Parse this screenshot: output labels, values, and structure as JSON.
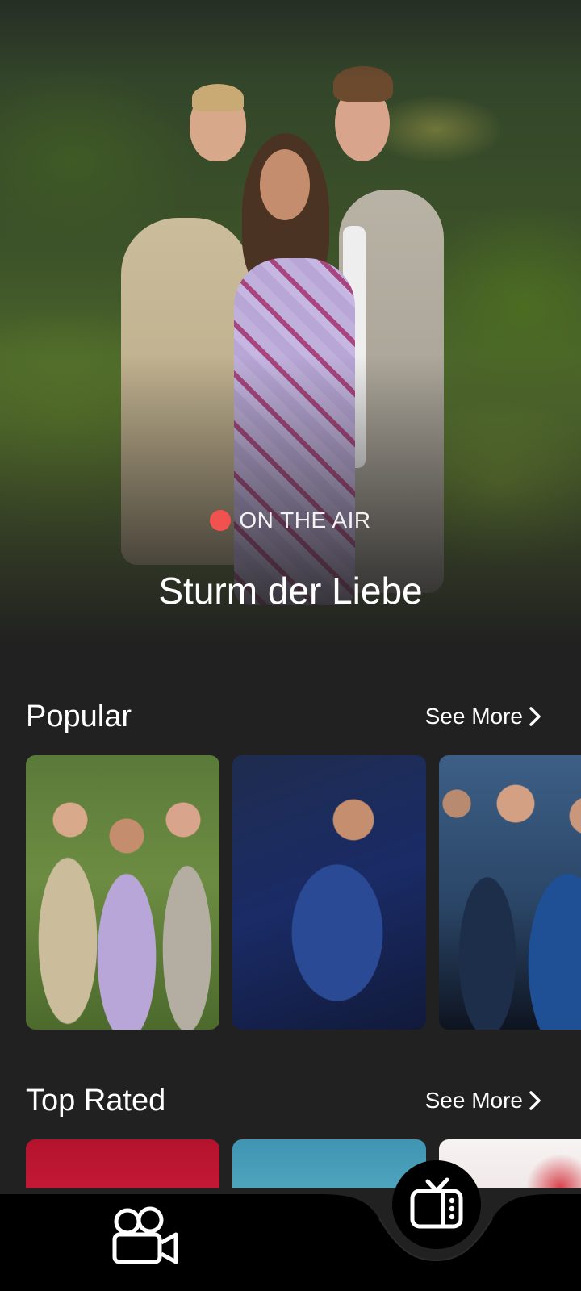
{
  "hero": {
    "status_label": "ON THE AIR",
    "status_color": "#f2524f",
    "title": "Sturm der Liebe"
  },
  "sections": {
    "popular": {
      "title": "Popular",
      "see_more": "See More",
      "cards": [
        "poster-sturm-der-liebe",
        "poster-tonight-show",
        "poster-medical-drama"
      ]
    },
    "top_rated": {
      "title": "Top Rated",
      "see_more": "See More",
      "cards": [
        "poster-anime-red",
        "poster-sky-blue",
        "poster-anime-white"
      ]
    }
  },
  "bottom_nav": {
    "items": [
      {
        "icon": "movie-camera-icon",
        "active": false
      },
      {
        "icon": "tv-icon",
        "active": true
      }
    ],
    "background": "#000000"
  }
}
